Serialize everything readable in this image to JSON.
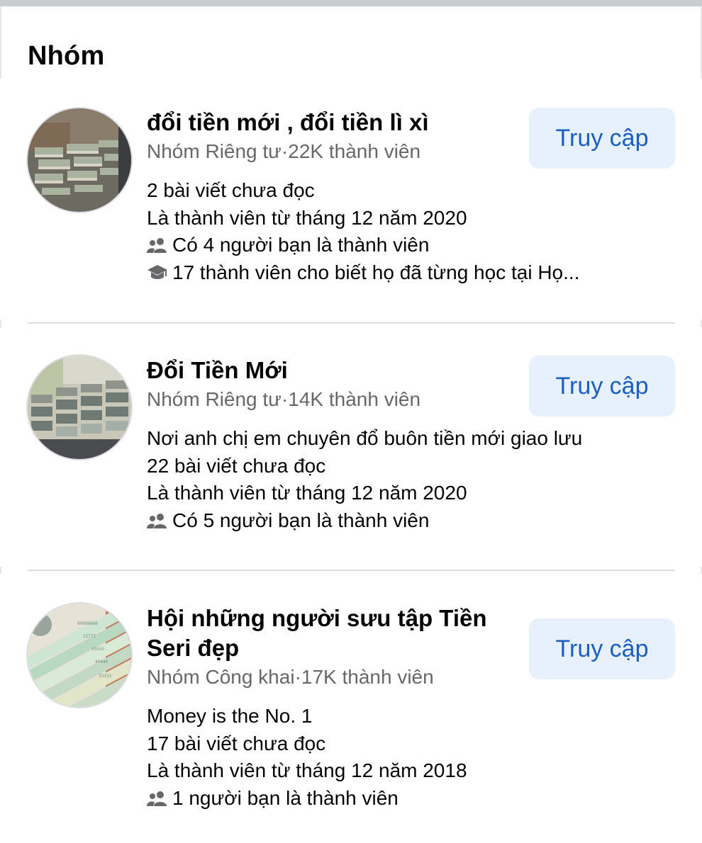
{
  "section": {
    "title": "Nhóm"
  },
  "groups": [
    {
      "name": "đổi tiền mới , đổi tiền lì xì",
      "privacy": "Nhóm Riêng tư",
      "members": "22K thành viên",
      "details": [
        {
          "icon": "",
          "text": "2 bài viết chưa đọc"
        },
        {
          "icon": "",
          "text": "Là thành viên từ tháng 12 năm 2020"
        },
        {
          "icon": "friends-icon",
          "text": "Có 4 người bạn là thành viên"
        },
        {
          "icon": "graduation-cap-icon",
          "text": "17 thành viên cho biết họ đã từng học tại Họ..."
        }
      ],
      "button": "Truy cập"
    },
    {
      "name": "Đổi Tiền Mới",
      "privacy": "Nhóm Riêng tư",
      "members": "14K thành viên",
      "details": [
        {
          "icon": "",
          "text": "Nơi anh chị em chuyên đổ buôn tiền mới giao lưu"
        },
        {
          "icon": "",
          "text": "22 bài viết chưa đọc"
        },
        {
          "icon": "",
          "text": "Là thành viên từ tháng 12 năm 2020"
        },
        {
          "icon": "friends-icon",
          "text": "Có 5 người bạn là thành viên"
        }
      ],
      "button": "Truy cập"
    },
    {
      "name": "Hội những người sưu tập Tiền Seri đẹp",
      "privacy": "Nhóm Công khai",
      "members": "17K thành viên",
      "details": [
        {
          "icon": "",
          "text": "Money is the No. 1"
        },
        {
          "icon": "",
          "text": "17 bài viết chưa đọc"
        },
        {
          "icon": "",
          "text": "Là thành viên từ tháng 12 năm 2018"
        },
        {
          "icon": "friends-icon",
          "text": "1 người bạn là thành viên"
        }
      ],
      "button": "Truy cập"
    }
  ],
  "separator": "·",
  "colors": {
    "button_bg": "#e7f0fd",
    "button_text": "#1b5fbf",
    "meta_text": "#65676b",
    "icon": "#65676b"
  }
}
